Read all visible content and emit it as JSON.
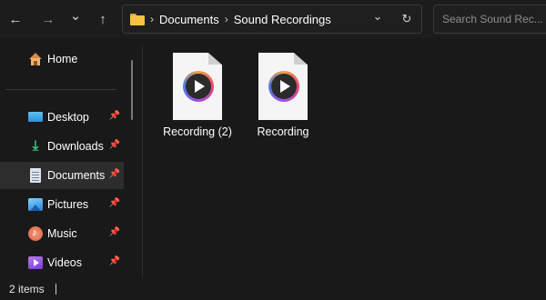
{
  "toolbar": {
    "back_icon": "←",
    "forward_icon": "→",
    "recent_icon": "⌄",
    "up_icon": "↑"
  },
  "address": {
    "separator": "›",
    "crumbs": [
      "Documents",
      "Sound Recordings"
    ],
    "dropdown_icon": "⌄",
    "refresh_icon": "↻"
  },
  "search": {
    "placeholder": "Search Sound Rec..."
  },
  "sidebar": {
    "pin_glyph": "📌",
    "home": "Home",
    "items": [
      {
        "label": "Desktop",
        "icon": "desktop-icon",
        "pinned": true
      },
      {
        "label": "Downloads",
        "icon": "downloads-icon",
        "pinned": true
      },
      {
        "label": "Documents",
        "icon": "documents-icon",
        "pinned": true,
        "selected": true
      },
      {
        "label": "Pictures",
        "icon": "pictures-icon",
        "pinned": true
      },
      {
        "label": "Music",
        "icon": "music-icon",
        "pinned": true
      },
      {
        "label": "Videos",
        "icon": "videos-icon",
        "pinned": true
      }
    ]
  },
  "files": [
    {
      "name": "Recording (2)",
      "icon": "media-player-icon"
    },
    {
      "name": "Recording",
      "icon": "media-player-icon"
    }
  ],
  "status": {
    "item_count": "2 items"
  },
  "colors": {
    "background": "#191919",
    "selected": "#2d2d2d",
    "folder": "#f6c244"
  }
}
